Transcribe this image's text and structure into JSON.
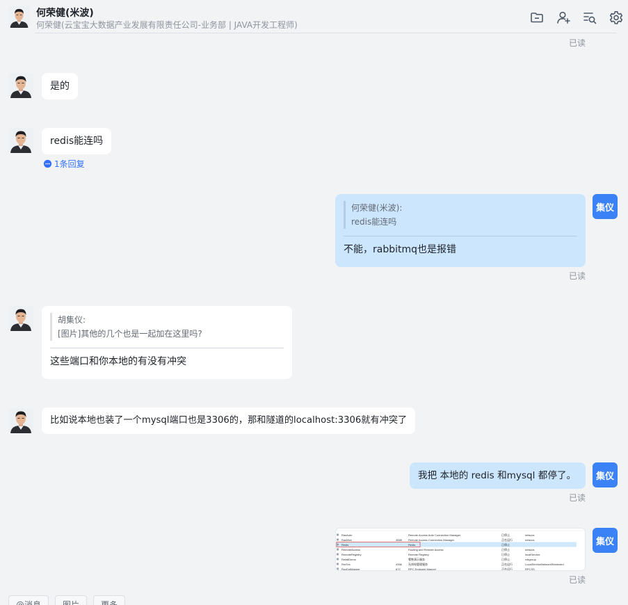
{
  "header": {
    "name": "何荣健(米波)",
    "subtitle": "何荣健(云宝宝大数据产业发展有限责任公司-业务部 | JAVA开发工程师)",
    "icons": [
      "folder-icon",
      "add-member-icon",
      "search-messages-icon",
      "settings-icon"
    ]
  },
  "me": {
    "avatar_text": "集仪"
  },
  "messages": [
    {
      "read": "已读"
    },
    {
      "text": "是的"
    },
    {
      "text": "redis能连吗",
      "reply_count": "1条回复"
    },
    {
      "quote_author": "何荣健(米波):",
      "quote_text": "redis能连吗",
      "text": "不能，rabbitmq也是报错",
      "read": "已读"
    },
    {
      "quote_author": "胡集仪:",
      "quote_text": "[图片]其他的几个也是一起加在这里吗?",
      "text": "这些端口和你本地的有没有冲突"
    },
    {
      "text": "比如说本地也装了一个mysql端口也是3306的，那和隧道的localhost:3306就有冲突了"
    },
    {
      "text": "我把 本地的 redis 和mysql 都停了。",
      "read": "已读"
    },
    {
      "image_rows": [
        [
          "RasAuto",
          "",
          "Remote Access Auto Connection Manager",
          "已停止",
          "netsvcs"
        ],
        [
          "RasMan",
          "4688",
          "Remote Access Connection Manager",
          "正在运行",
          "netsvcs"
        ],
        [
          "Redis",
          "",
          "Redis",
          "已停止",
          ""
        ],
        [
          "RemoteAccess",
          "",
          "Routing and Remote Access",
          "已停止",
          "netsvcs"
        ],
        [
          "RemoteRegistry",
          "",
          "Remote Registry",
          "已停止",
          "localService"
        ],
        [
          "RetailDemo",
          "",
          "零售演示服务",
          "已停止",
          "rdxgroup"
        ],
        [
          "RmSvc",
          "4356",
          "无线电管理服务",
          "正在运行",
          "LocalServiceNetworkRestricted"
        ],
        [
          "RpcEptMapper",
          "872",
          "RPC Endpoint Mapper",
          "正在运行",
          "RPCSS"
        ]
      ],
      "read": "已读"
    }
  ],
  "footer_tabs": [
    "@消息",
    "图片",
    "更多"
  ]
}
